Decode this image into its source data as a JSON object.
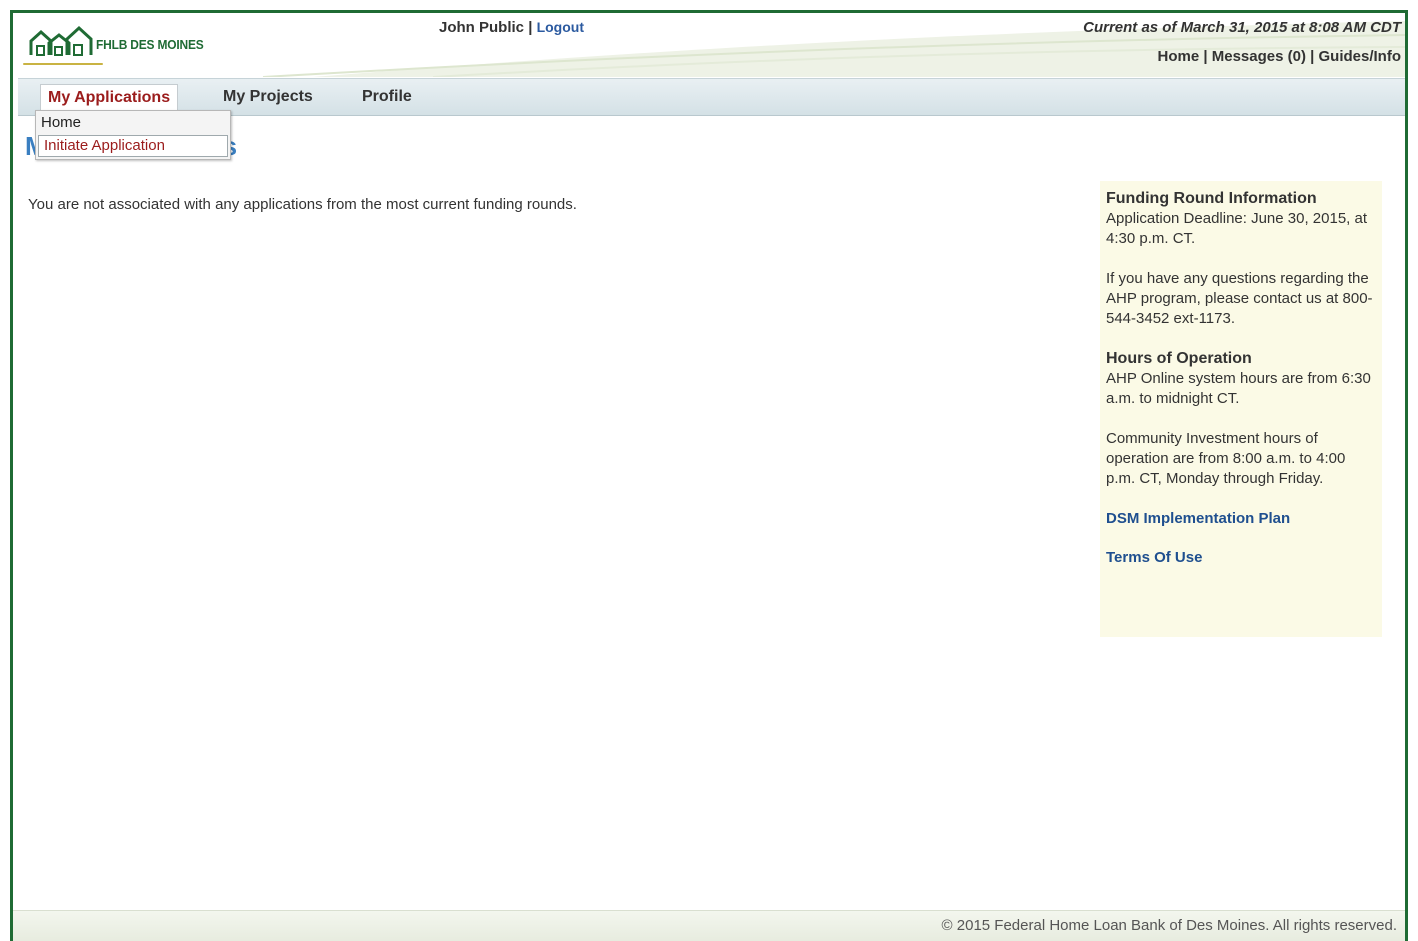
{
  "header": {
    "logo_text": "FHLB DES MOINES",
    "user_name": "John Public",
    "separator": "|",
    "logout_label": "Logout",
    "as_of": "Current as of March 31, 2015 at 8:08 AM CDT",
    "links": {
      "home": "Home",
      "messages": "Messages (0)",
      "guides": "Guides/Info"
    }
  },
  "nav": {
    "tabs": [
      {
        "label": "My Applications",
        "active": true
      },
      {
        "label": "My Projects",
        "active": false
      },
      {
        "label": "Profile",
        "active": false
      }
    ],
    "dropdown": [
      {
        "label": "Home"
      },
      {
        "label": "Initiate Application"
      }
    ]
  },
  "main": {
    "title_visible_start": "M",
    "title_visible_end": "s",
    "message": "You are not associated with any applications from the most current funding rounds."
  },
  "sidebar": {
    "funding_heading": "Funding Round Information",
    "deadline": "Application Deadline: June 30, 2015, at 4:30 p.m. CT.",
    "questions": "If you have any questions regarding the AHP program, please contact us at 800-544-3452 ext-1173.",
    "hours_heading": "Hours of Operation",
    "hours_online": "AHP Online system hours are from 6:30 a.m. to midnight CT.",
    "hours_ci": "Community Investment hours of operation are from 8:00 a.m. to 4:00 p.m. CT, Monday through Friday.",
    "link_dsm": "DSM Implementation Plan",
    "link_terms": "Terms Of Use"
  },
  "footer": {
    "copyright": "© 2015 Federal Home Loan Bank of Des Moines. All rights reserved."
  },
  "colors": {
    "brand_green": "#1f6b34",
    "accent_red": "#9b1c1c",
    "link_blue": "#1f4f8f",
    "title_blue": "#3a7fc1",
    "sidebar_bg": "#fbfae6"
  }
}
